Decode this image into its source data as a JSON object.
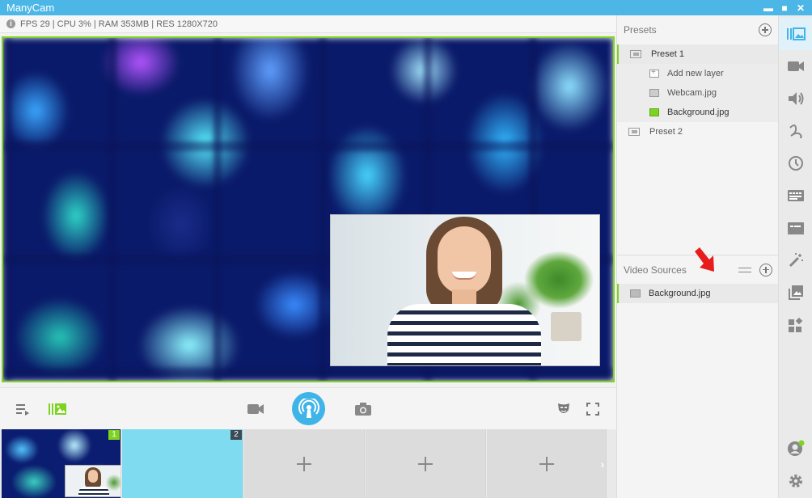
{
  "window": {
    "title": "ManyCam",
    "controls": {
      "minimize": "▬",
      "maximize": "■",
      "close": "✕"
    }
  },
  "status": {
    "text": "FPS 29 | CPU 3% | RAM 353MB | RES 1280X720",
    "info_icon": "i"
  },
  "toolbar": {
    "icons": [
      "playlist-icon",
      "layers-icon",
      "video-camera-icon",
      "broadcast-icon",
      "camera-snapshot-icon",
      "mask-icon",
      "fullscreen-icon"
    ]
  },
  "preset_strip": {
    "slots": [
      {
        "number": "1",
        "badge_color": "#7ed321"
      },
      {
        "number": "2",
        "badge_color": "#3b4a55"
      }
    ],
    "next_arrow": "›"
  },
  "presets": {
    "title": "Presets",
    "items": [
      {
        "label": "Preset 1",
        "layers": [
          {
            "label": "Add new layer"
          },
          {
            "label": "Webcam.jpg"
          },
          {
            "label": "Background.jpg"
          }
        ]
      },
      {
        "label": "Preset 2"
      }
    ]
  },
  "video_sources": {
    "title": "Video Sources",
    "items": [
      {
        "label": "Background.jpg"
      }
    ]
  },
  "rail": {
    "icons": [
      "presets-icon",
      "video-sources-icon",
      "audio-icon",
      "draw-icon",
      "clock-icon",
      "lower-thirds-icon",
      "screen-icon",
      "effects-wand-icon",
      "gallery-icon",
      "widgets-icon",
      "account-icon",
      "settings-icon"
    ]
  },
  "colors": {
    "accent": "#4cb7e6",
    "active_green": "#7ed321",
    "broadcast_blue": "#3fb4e8",
    "annotation_red": "#e81c1c"
  }
}
